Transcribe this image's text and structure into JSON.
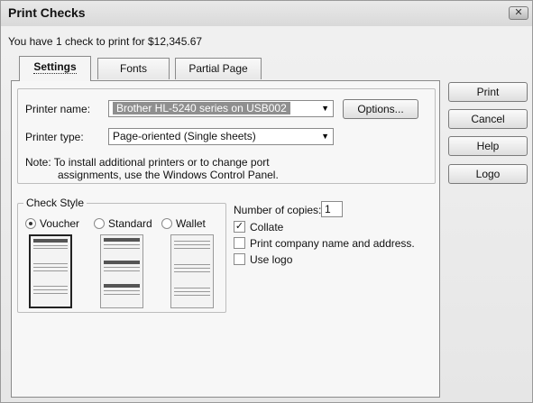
{
  "window": {
    "title": "Print Checks",
    "close_label": "✕",
    "summary": "You have 1 check to print for $12,345.67"
  },
  "tabs": [
    {
      "label": "Settings",
      "active": true
    },
    {
      "label": "Fonts",
      "active": false
    },
    {
      "label": "Partial Page",
      "active": false
    }
  ],
  "printer": {
    "name_label": "Printer name:",
    "name_value": "Brother HL-5240 series on USB002",
    "options_label": "Options...",
    "type_label": "Printer type:",
    "type_value": "Page-oriented (Single sheets)",
    "note_line1": "Note: To install additional printers or to change port",
    "note_line2": "assignments, use the Windows Control Panel."
  },
  "check_style": {
    "label": "Check Style",
    "options": [
      {
        "label": "Voucher",
        "selected": true
      },
      {
        "label": "Standard",
        "selected": false
      },
      {
        "label": "Wallet",
        "selected": false
      }
    ]
  },
  "copies": {
    "label": "Number of copies:",
    "value": "1"
  },
  "checkboxes": [
    {
      "label": "Collate",
      "checked": true
    },
    {
      "label": "Print company name and address.",
      "checked": false
    },
    {
      "label": "Use logo",
      "checked": false
    }
  ],
  "buttons": {
    "print": "Print",
    "cancel": "Cancel",
    "help": "Help",
    "logo": "Logo"
  }
}
